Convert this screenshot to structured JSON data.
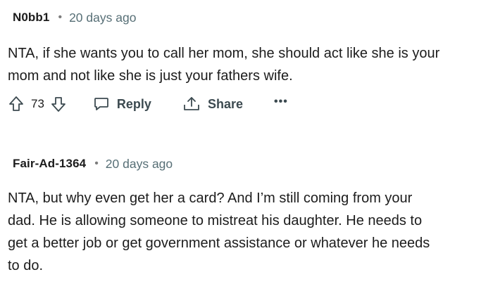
{
  "comments": [
    {
      "username": "N0bb1",
      "separator": "•",
      "timestamp": "20 days ago",
      "body_lines": [
        "NTA, if she wants you to call her mom, she should act like she is your",
        "mom and not like she is just your fathers wife."
      ],
      "votes": "73",
      "actions": {
        "reply_label": "Reply",
        "share_label": "Share",
        "more_label": "•••"
      },
      "icons": {
        "upvote": "arrow-up-outline-icon",
        "downvote": "arrow-down-outline-icon",
        "reply": "speech-bubble-icon",
        "share": "share-upload-icon"
      }
    },
    {
      "username": "Fair-Ad-1364",
      "separator": "•",
      "timestamp": "20 days ago",
      "body_lines": [
        "NTA, but why even get her a card? And I’m still coming from your",
        "dad. He is allowing someone to mistreat his daughter. He needs to",
        "get a better job or get government assistance or whatever he needs",
        "to do."
      ]
    }
  ],
  "colors": {
    "text": "#1c1c1c",
    "muted": "#576f76",
    "action": "#3c4a50",
    "background": "#ffffff"
  }
}
